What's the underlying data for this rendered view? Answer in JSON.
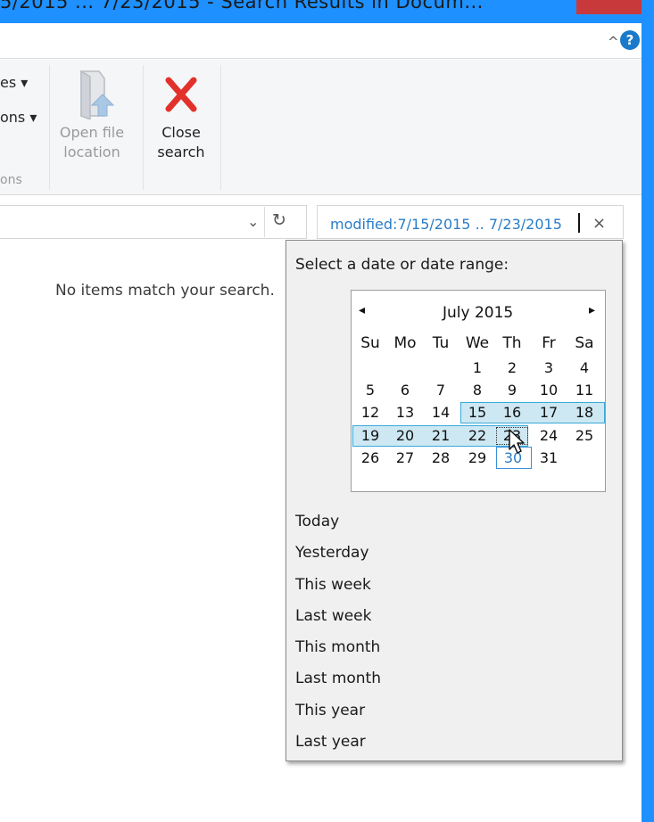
{
  "window": {
    "title_fragment": "5/2015 ... 7/23/2015 - Search Results in Docum...",
    "colors": {
      "frame": "#1e90ff",
      "close": "#c8393b",
      "accent_text": "#2a7cc7",
      "selection_fill": "#cde8f3",
      "selection_border": "#39a9d9"
    }
  },
  "ribbon": {
    "help_icon": "?",
    "collapse_icon": "^",
    "partial_1": "es ▾",
    "partial_2": "ons ▾",
    "partial_group": "ons",
    "open_file_location": {
      "line1": "Open file",
      "line2": "location",
      "icon": "folder-arrow-icon"
    },
    "close_search": {
      "line1": "Close",
      "line2": "search",
      "icon": "red-x-icon"
    }
  },
  "address": {
    "refresh_icon": "↻",
    "dropdown_icon": "⌄"
  },
  "search": {
    "value": "modified:7/15/2015 .. 7/23/2015",
    "clear_icon": "×"
  },
  "content": {
    "empty_message": "No items match your search."
  },
  "date_picker": {
    "heading": "Select a date or date range:",
    "month": "July 2015",
    "prev_icon": "◂",
    "next_icon": "▸",
    "weekdays": [
      "Su",
      "Mo",
      "Tu",
      "We",
      "Th",
      "Fr",
      "Sa"
    ],
    "weeks": [
      [
        "",
        "",
        "",
        "1",
        "2",
        "3",
        "4"
      ],
      [
        "5",
        "6",
        "7",
        "8",
        "9",
        "10",
        "11"
      ],
      [
        "12",
        "13",
        "14",
        "15",
        "16",
        "17",
        "18"
      ],
      [
        "19",
        "20",
        "21",
        "22",
        "23",
        "24",
        "25"
      ],
      [
        "26",
        "27",
        "28",
        "29",
        "30",
        "31",
        ""
      ]
    ],
    "selected_range": [
      "15",
      "16",
      "17",
      "18",
      "19",
      "20",
      "21",
      "22",
      "23"
    ],
    "today": "30",
    "options": [
      "Today",
      "Yesterday",
      "This week",
      "Last week",
      "This month",
      "Last month",
      "This year",
      "Last year"
    ]
  }
}
